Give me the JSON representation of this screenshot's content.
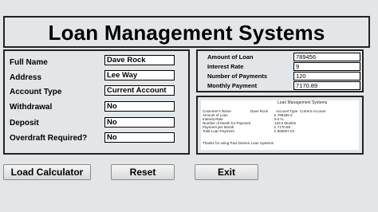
{
  "header": {
    "title": "Loan Management Systems"
  },
  "customer": {
    "full_name_label": "Full Name",
    "full_name_value": "Dave Rock",
    "address_label": "Address",
    "address_value": "Lee Way",
    "account_type_label": "Account Type",
    "account_type_value": "Current Account",
    "withdrawal_label": "Withdrawal",
    "withdrawal_value": "No",
    "deposit_label": "Deposit",
    "deposit_value": "No",
    "overdraft_label": "Overdraft Required?",
    "overdraft_value": "No"
  },
  "loan": {
    "amount_label": "Amount of Loan",
    "amount_value": "789456",
    "rate_label": "Interest Rate",
    "rate_value": "9",
    "payments_label": "Number of Payments",
    "payments_value": "120",
    "monthly_label": "Monthly Payment",
    "monthly_value": "7170.89"
  },
  "receipt": {
    "heading": "Loan Management Systems",
    "col1": "Customer's Name",
    "col1_val": "Dave Rock",
    "col2": "Account Type",
    "col2_val": "Current Account",
    "rows": [
      {
        "label": "Amount of Loan",
        "value": "£ 789456.0"
      },
      {
        "label": "Interest Rate",
        "value": "9.0 %"
      },
      {
        "label": "Number of Month for Payment",
        "value": "120.0 Months"
      },
      {
        "label": "Payment per Month",
        "value": "£ 7170.89"
      },
      {
        "label": "Total Loan Payment",
        "value": "£ 860507.04"
      }
    ],
    "footer": "Thanks for  using Paul Damen Loan Systems"
  },
  "buttons": {
    "load": "Load Calculator",
    "reset": "Reset",
    "exit": "Exit"
  }
}
